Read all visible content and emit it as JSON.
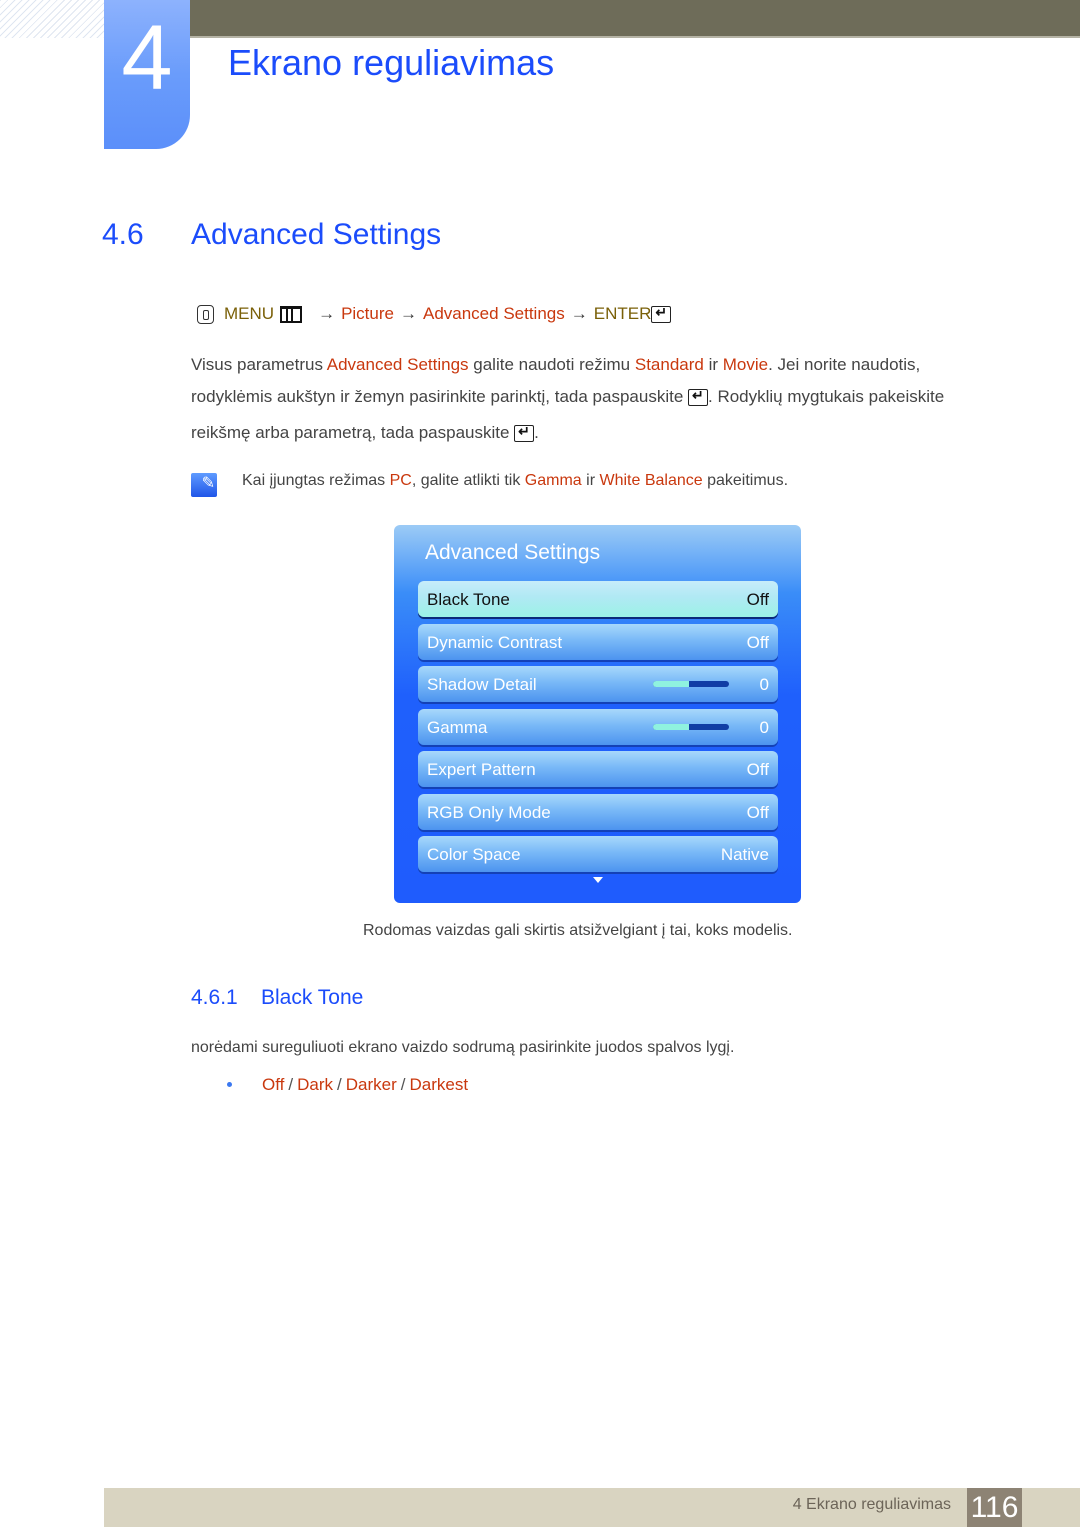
{
  "chapter": {
    "number": "4",
    "title": "Ekrano reguliavimas"
  },
  "section": {
    "number": "4.6",
    "title": "Advanced Settings"
  },
  "menu_path": {
    "menu": "MENU",
    "arrow": "→",
    "picture": "Picture",
    "advanced": "Advanced Settings",
    "enter": "ENTER"
  },
  "intro": {
    "line1": {
      "a": "Visus parametrus ",
      "b": "Advanced Settings",
      "c": " galite naudoti režimu ",
      "d": "Standard",
      "e": " ir ",
      "f": "Movie",
      "g": ". Jei norite naudotis,"
    },
    "line2": {
      "a": "rodyklėmis aukštyn ir žemyn pasirinkite parinktį, tada paspauskite ",
      "b": ". Rodyklių mygtukais pakeiskite"
    },
    "line3": {
      "a": "reikšmę arba parametrą, tada paspauskite ",
      "b": "."
    }
  },
  "note": {
    "a": "Kai įjungtas režimas ",
    "b": "PC",
    "c": ", galite atlikti tik ",
    "d": "Gamma",
    "e": " ir ",
    "f": "White Balance",
    "g": " pakeitimus."
  },
  "osd": {
    "title": "Advanced Settings",
    "items": [
      {
        "label": "Black Tone",
        "value": "Off",
        "selected": true
      },
      {
        "label": "Dynamic Contrast",
        "value": "Off"
      },
      {
        "label": "Shadow Detail",
        "value": "0",
        "slider_fraction": 0.47
      },
      {
        "label": "Gamma",
        "value": "0",
        "slider_fraction": 0.47
      },
      {
        "label": "Expert Pattern",
        "value": "Off"
      },
      {
        "label": "RGB Only Mode",
        "value": "Off"
      },
      {
        "label": "Color Space",
        "value": "Native"
      }
    ],
    "more_icon": "triangle-down"
  },
  "caption": "Rodomas vaizdas gali skirtis atsižvelgiant į tai, koks modelis.",
  "subsection": {
    "number": "4.6.1",
    "title": "Black Tone",
    "description": "norėdami sureguliuoti ekrano vaizdo sodrumą pasirinkite juodos spalvos lygį.",
    "options": [
      "Off",
      "Dark",
      "Darker",
      "Darkest"
    ],
    "separator": "/"
  },
  "footer": {
    "text": "4 Ekrano reguliavimas",
    "page": "116"
  },
  "colors": {
    "heading_blue": "#1b4cfb",
    "highlight_red": "#c9380e",
    "menu_gold": "#7a6008",
    "top_bar": "#6e6c59",
    "footer_bg": "#d9d4c1",
    "page_num_bg": "#8d8374"
  }
}
